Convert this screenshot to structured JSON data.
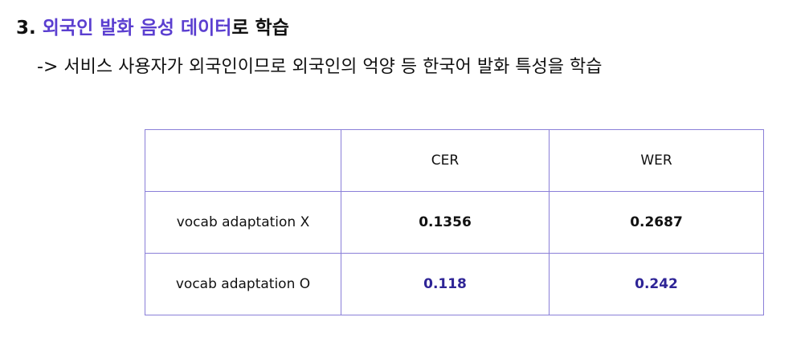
{
  "heading": {
    "number": "3.",
    "highlight": "외국인 발화 음성 데이터",
    "rest": "로 학습"
  },
  "subheading": "-> 서비스 사용자가 외국인이므로 외국인의 억양 등 한국어 발화 특성을 학습",
  "table": {
    "headers": [
      "",
      "CER",
      "WER"
    ],
    "rows": [
      {
        "label": "vocab adaptation X",
        "cer": "0.1356",
        "wer": "0.2687"
      },
      {
        "label": "vocab adaptation O",
        "cer": "0.118",
        "wer": "0.242"
      }
    ]
  },
  "colors": {
    "heading_accent": "#5b3fd0",
    "improved_value": "#2e2496",
    "table_border": "#8a7fd8"
  }
}
